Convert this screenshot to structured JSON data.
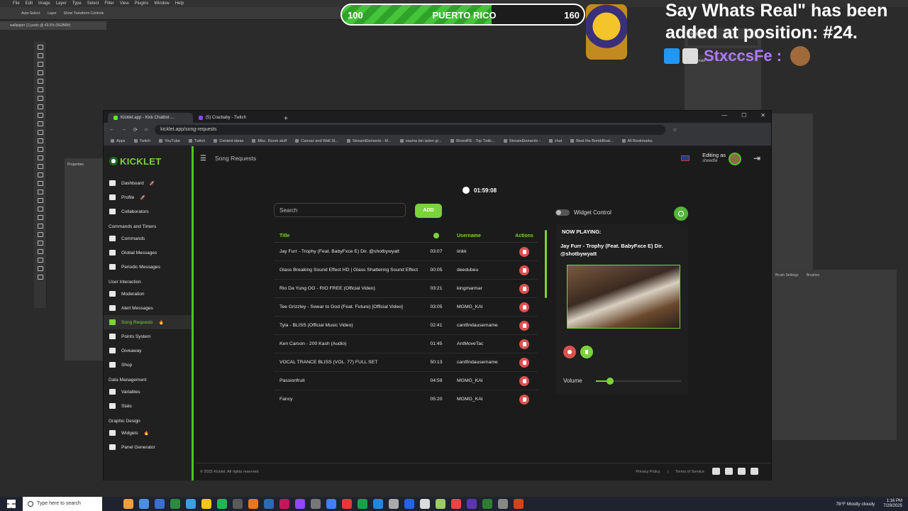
{
  "photoshop": {
    "menu": [
      "File",
      "Edit",
      "Image",
      "Layer",
      "Type",
      "Select",
      "Filter",
      "View",
      "Plugins",
      "Window",
      "Help"
    ],
    "options": [
      "Auto-Select:",
      "Layer",
      "Show Transform Controls"
    ],
    "doc_tab": "wallpaper (1).psdc @ 43.5% (RGB/8#)",
    "properties_title": "Properties",
    "paragraph_title": "Paragraph",
    "hyphenate": "Hyphenate",
    "brush_settings": "Brush Settings",
    "brushes": "Brushes"
  },
  "overlay": {
    "health_left": "100",
    "health_label": "PUERTO RICO",
    "health_right": "160",
    "health_fill_fraction": 0.62,
    "chat_text": "Say Whats Real\" has been added at position: #24.",
    "chat_username": "StxccsFe :"
  },
  "browser": {
    "tabs": [
      {
        "label": "Kicklet.app - Kick Chatbot ..."
      },
      {
        "label": "(5) Cracbaby - Twitch"
      }
    ],
    "url": "kicklet.app/song-requests",
    "bookmarks": [
      "Apps",
      "Twitch",
      "YouTube",
      "Twitch",
      "Content ideas",
      "Misc. Room stuff",
      "Canvas and Wall St...",
      "StreamElements - M...",
      "osama bin laden gr...",
      "SheedFE - Top Twitc...",
      "StreamElements -",
      "chat",
      "Beat the BombBoat...",
      "All Bookmarks"
    ]
  },
  "app": {
    "logo": "KICKLET",
    "page_title": "Song Requests",
    "editing_as_label": "Editing as",
    "editing_as_user": "sheedfe",
    "nav": [
      {
        "type": "item",
        "label": "Dashboard",
        "icon": "dashboard-icon",
        "emoji": "🚀"
      },
      {
        "type": "item",
        "label": "Profile",
        "icon": "profile-icon",
        "emoji": "🚀"
      },
      {
        "type": "item",
        "label": "Collaborators",
        "icon": "collaborators-icon"
      },
      {
        "type": "section",
        "label": "Commands and Timers"
      },
      {
        "type": "item",
        "label": "Commands",
        "icon": "commands-icon"
      },
      {
        "type": "item",
        "label": "Global Messages",
        "icon": "global-messages-icon"
      },
      {
        "type": "item",
        "label": "Periodic Messages",
        "icon": "periodic-messages-icon"
      },
      {
        "type": "section",
        "label": "User Interaction"
      },
      {
        "type": "item",
        "label": "Moderation",
        "icon": "shield-icon"
      },
      {
        "type": "item",
        "label": "Alert Messages",
        "icon": "alert-icon"
      },
      {
        "type": "item",
        "label": "Song Requests",
        "icon": "music-icon",
        "emoji": "🔥",
        "active": true
      },
      {
        "type": "item",
        "label": "Points System",
        "icon": "star-icon"
      },
      {
        "type": "item",
        "label": "Giveaway",
        "icon": "gift-icon"
      },
      {
        "type": "item",
        "label": "Shop",
        "icon": "cart-icon"
      },
      {
        "type": "section",
        "label": "Data Management"
      },
      {
        "type": "item",
        "label": "Variables",
        "icon": "variables-icon"
      },
      {
        "type": "item",
        "label": "Stats",
        "icon": "stats-icon"
      },
      {
        "type": "section",
        "label": "Graphic Design"
      },
      {
        "type": "item",
        "label": "Widgets",
        "icon": "widgets-icon",
        "emoji": "🔥"
      },
      {
        "type": "item",
        "label": "Panel Generator",
        "icon": "panel-icon"
      }
    ],
    "timer": "01:59:08",
    "search_placeholder": "Search",
    "add_label": "ADD",
    "table": {
      "headers": {
        "title": "Title",
        "duration": "",
        "username": "Username",
        "actions": "Actions"
      },
      "rows": [
        {
          "title": "Jay Furr - Trophy (Feat. BabyFxce E) Dir. @shotbywyatt",
          "duration": "03:07",
          "username": "iinkk"
        },
        {
          "title": "Glass Breaking Sound Effect HD | Glass Shattering Sound Effect",
          "duration": "00:05",
          "username": "deedubeu"
        },
        {
          "title": "Rio Da Yung OG - RIO FREE (Official Video)",
          "duration": "03:21",
          "username": "kingmarmar"
        },
        {
          "title": "Tee Grizzley - Swear to God (Feat. Future) [Official Video]",
          "duration": "03:05",
          "username": "MGMG_KAI"
        },
        {
          "title": "Tyla - BLISS (Official Music Video)",
          "duration": "02:41",
          "username": "cantfindausername"
        },
        {
          "title": "Ken Carson - 200 Kash (Audio)",
          "duration": "01:45",
          "username": "AntMoveTac"
        },
        {
          "title": "VOCAL TRANCE BLISS (VOL. 77) FULL SET",
          "duration": "50:13",
          "username": "cantfindausername"
        },
        {
          "title": "Passionfruit",
          "duration": "04:59",
          "username": "MGMG_KAI"
        },
        {
          "title": "Fancy",
          "duration": "05:20",
          "username": "MGMG_KAI"
        }
      ]
    },
    "widget_control_label": "Widget Control",
    "now_playing_label": "NOW PLAYING:",
    "now_playing_title": "Jay Furr - Trophy (Feat. BabyFxce E) Dir. @shotbywyatt",
    "volume_label": "Volume",
    "volume_fraction": 0.17,
    "footer_copyright": "© 2025 Kicklet. All rights reserved.",
    "footer_privacy": "Privacy Policy",
    "footer_separator": "|",
    "footer_terms": "Terms of Service"
  },
  "taskbar": {
    "search_placeholder": "Type here to search",
    "weather": "78°F  Mostly cloudy",
    "time": "1:16 PM",
    "date": "7/29/2025"
  },
  "colors": {
    "accent": "#7bd33a",
    "danger": "#d9534f",
    "panel": "#202020"
  }
}
